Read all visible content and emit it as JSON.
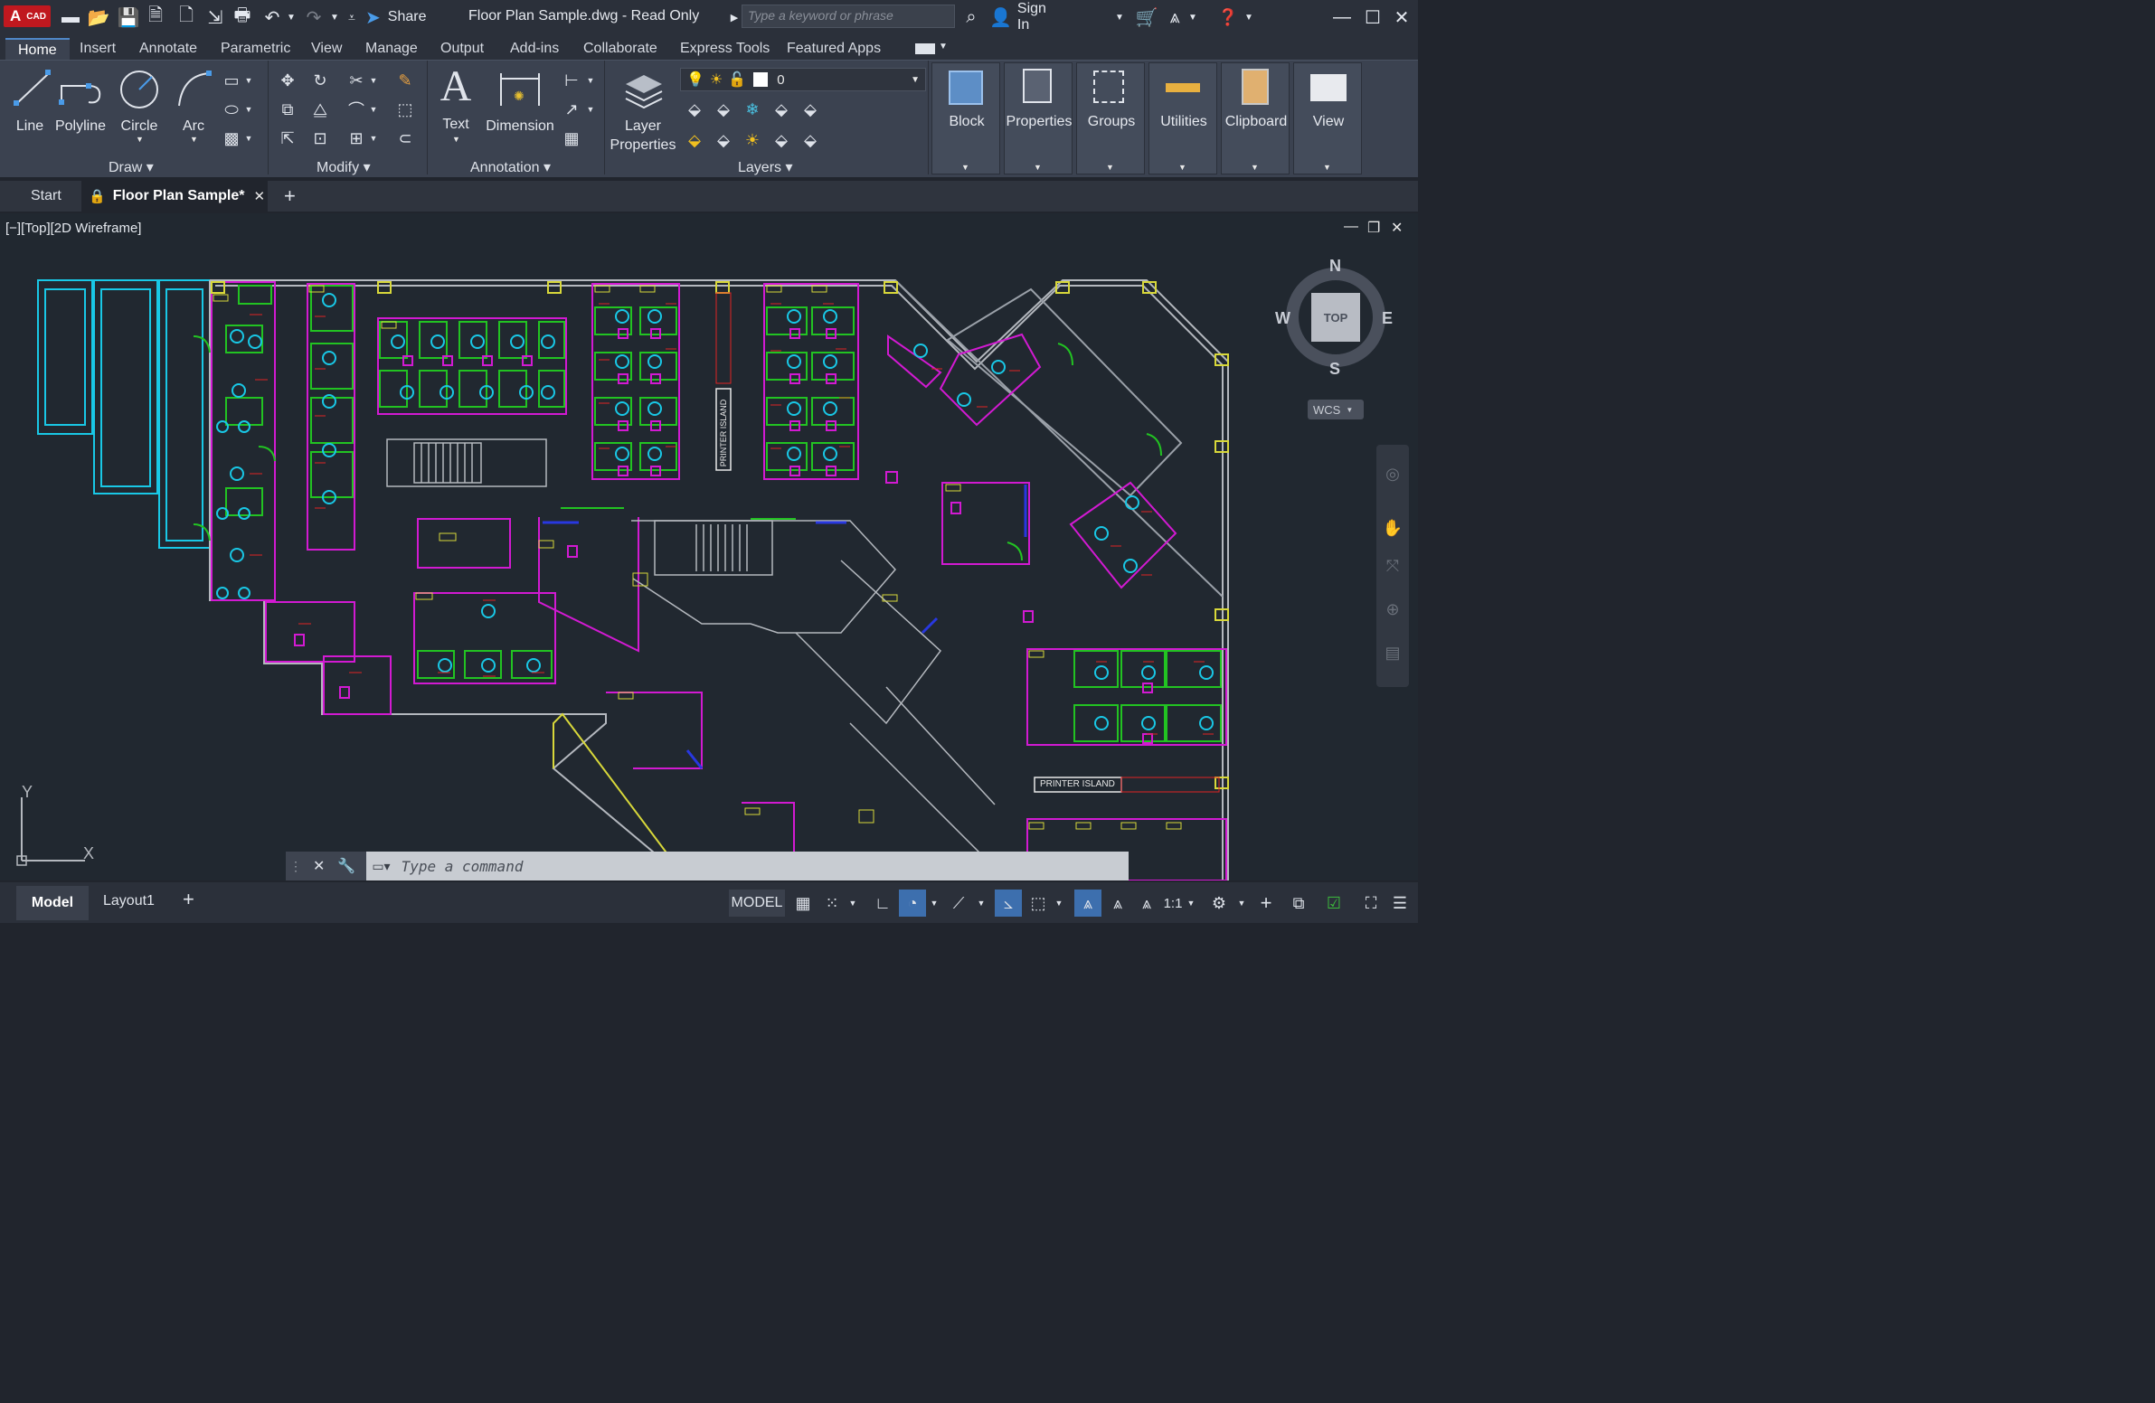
{
  "app": {
    "logo_text": "CAD",
    "logo_letter": "A",
    "title": "Floor Plan Sample.dwg - Read Only"
  },
  "titlebar": {
    "share_label": "Share",
    "search_placeholder": "Type a keyword or phrase",
    "signin_label": "Sign In"
  },
  "menu": {
    "tabs": [
      "Home",
      "Insert",
      "Annotate",
      "Parametric",
      "View",
      "Manage",
      "Output",
      "Add-ins",
      "Collaborate",
      "Express Tools",
      "Featured Apps"
    ]
  },
  "ribbon": {
    "draw": {
      "title": "Draw",
      "tools": [
        "Line",
        "Polyline",
        "Circle",
        "Arc"
      ]
    },
    "modify": {
      "title": "Modify"
    },
    "annotation": {
      "title": "Annotation",
      "tools": [
        "Text",
        "Dimension"
      ]
    },
    "layers": {
      "title": "Layers",
      "layer_props_1": "Layer",
      "layer_props_2": "Properties",
      "current_layer": "0"
    },
    "groups": [
      "Block",
      "Properties",
      "Groups",
      "Utilities",
      "Clipboard",
      "View"
    ]
  },
  "doctabs": {
    "start": "Start",
    "active": "Floor Plan Sample*"
  },
  "viewport": {
    "label": "[−][Top][2D Wireframe]",
    "viewcube": {
      "n": "N",
      "s": "S",
      "e": "E",
      "w": "W",
      "face": "TOP",
      "wcs": "WCS"
    },
    "ucs": {
      "x": "X",
      "y": "Y"
    },
    "printer_island_1": "PRINTER ISLAND",
    "printer_island_2": "PRINTER  ISLAND"
  },
  "command": {
    "placeholder": "Type a command"
  },
  "layout_tabs": {
    "model": "Model",
    "layout1": "Layout1"
  },
  "status": {
    "model": "MODEL",
    "scale": "1:1"
  },
  "colors": {
    "cyan": "#19c8e6",
    "magenta": "#d21ad2",
    "green": "#22c322",
    "yellow": "#d8d83a",
    "red": "#e02424",
    "gray": "#9aa0a8",
    "blue": "#2838e0"
  }
}
